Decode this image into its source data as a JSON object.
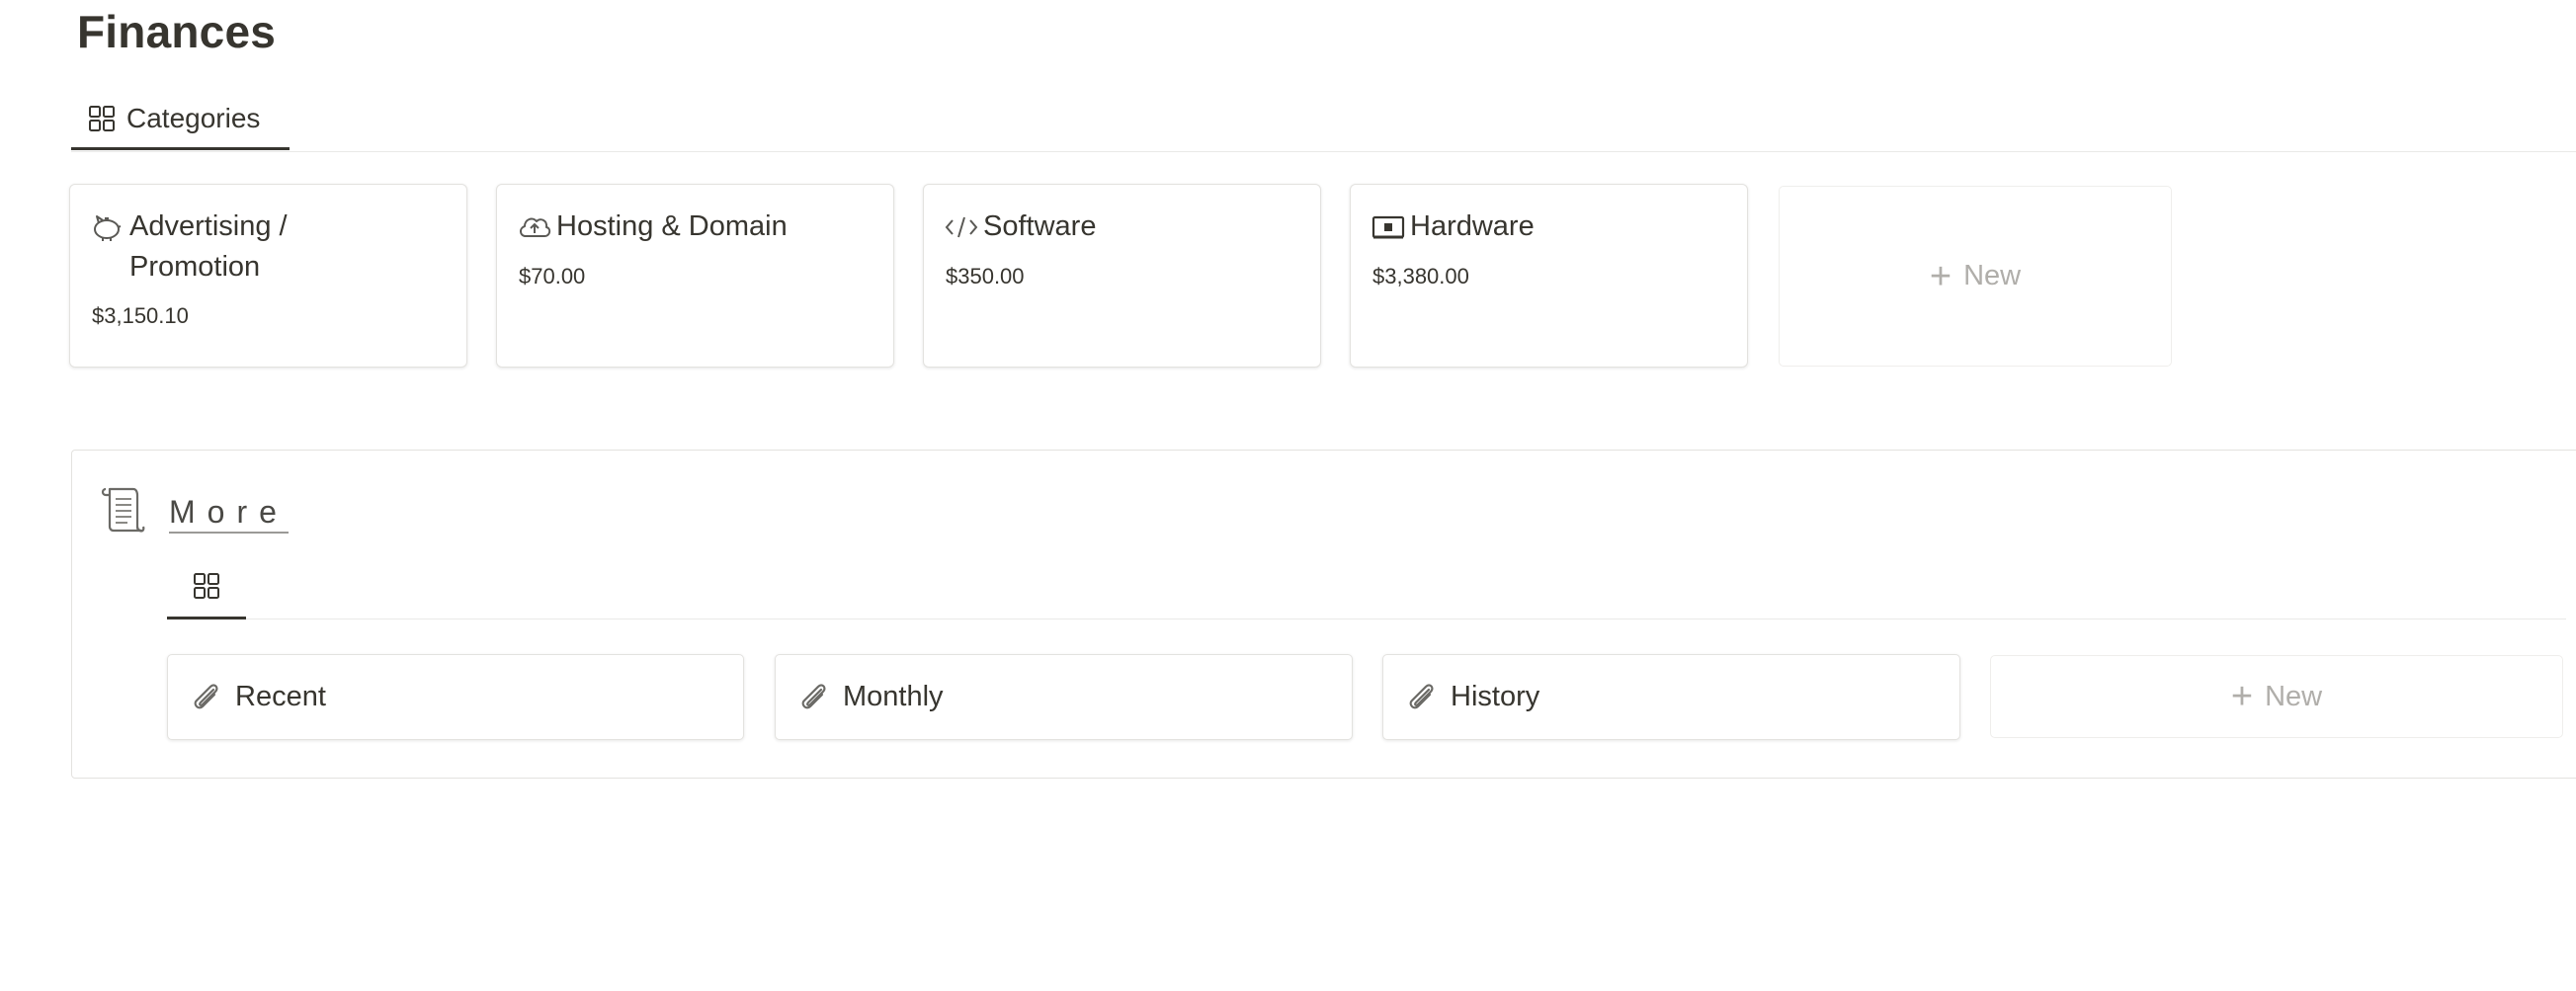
{
  "page": {
    "title": "Finances"
  },
  "view_tabs": [
    {
      "label": "Categories",
      "icon": "gallery-grid-icon"
    }
  ],
  "categories": [
    {
      "title": "Advertising / Promotion",
      "title_line1": "Advertising /",
      "title_line2": "Promotion",
      "amount": "$3,150.10",
      "icon": "piggy-bank-icon"
    },
    {
      "title": "Hosting & Domain",
      "amount": "$70.00",
      "icon": "cloud-upload-icon"
    },
    {
      "title": "Software",
      "amount": "$350.00",
      "icon": "code-icon"
    },
    {
      "title": "Hardware",
      "amount": "$3,380.00",
      "icon": "monitor-icon"
    }
  ],
  "new_card": {
    "label": "New"
  },
  "more": {
    "title": "More",
    "icon": "scroll-icon",
    "tab_icon": "gallery-grid-icon",
    "links": [
      {
        "label": "Recent",
        "icon": "paperclip-icon"
      },
      {
        "label": "Monthly",
        "icon": "paperclip-icon"
      },
      {
        "label": "History",
        "icon": "paperclip-icon"
      }
    ],
    "new_label": "New"
  },
  "colors": {
    "text": "#37352f",
    "border": "#e3e2df",
    "muted": "#b0aeaa"
  }
}
